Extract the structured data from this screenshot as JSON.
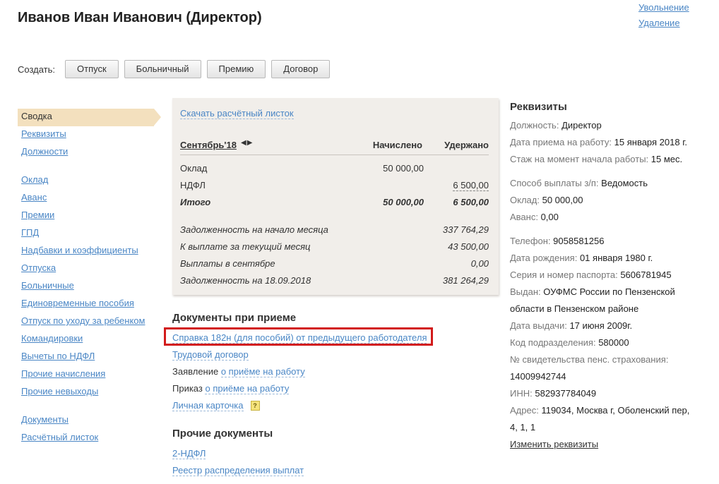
{
  "header": {
    "title": "Иванов Иван Иванович (Директор)",
    "dismiss": "Увольнение",
    "delete": "Удаление"
  },
  "create": {
    "label": "Создать:",
    "buttons": [
      "Отпуск",
      "Больничный",
      "Премию",
      "Договор"
    ]
  },
  "nav": {
    "items": [
      "Сводка",
      "Реквизиты",
      "Должности",
      "Оклад",
      "Аванс",
      "Премии",
      "ГПД",
      "Надбавки и коэффициенты",
      "Отпуска",
      "Больничные",
      "Единовременные пособия",
      "Отпуск по уходу за ребенком",
      "Командировки",
      "Вычеты по НДФЛ",
      "Прочие начисления",
      "Прочие невыходы",
      "Документы",
      "Расчётный листок"
    ]
  },
  "payslip": {
    "download": "Скачать расчётный листок",
    "month": "Сентябрь'18",
    "arrows": "◀▶",
    "col_accrued": "Начислено",
    "col_withheld": "Удержано",
    "rows": [
      {
        "label": "Оклад",
        "accrued": "50 000,00",
        "withheld": ""
      },
      {
        "label": "НДФЛ",
        "accrued": "",
        "withheld": "6 500,00"
      },
      {
        "label": "Итого",
        "accrued": "50 000,00",
        "withheld": "6 500,00"
      }
    ],
    "summary": [
      {
        "label": "Задолженность на начало месяца",
        "value": "337 764,29"
      },
      {
        "label": "К выплате за текущий месяц",
        "value": "43 500,00"
      },
      {
        "label": "Выплаты в сентябре",
        "value": "0,00"
      },
      {
        "label": "Задолженность на 18.09.2018",
        "value": "381 264,29"
      }
    ]
  },
  "hire_docs": {
    "heading": "Документы при приеме",
    "cert": "Справка 182н (для пособий) от предыдущего работодателя",
    "contract": "Трудовой договор",
    "application_prefix": "Заявление",
    "application_link": "о приёме на работу",
    "order_prefix": "Приказ",
    "order_link": "о приёме на работу",
    "card": "Личная карточка",
    "help": "?"
  },
  "other_docs": {
    "heading": "Прочие документы",
    "items": [
      "2-НДФЛ",
      "Реестр распределения выплат"
    ]
  },
  "requisites": {
    "title": "Реквизиты",
    "position_k": "Должность:",
    "position_v": "Директор",
    "hired_k": "Дата приема на работу:",
    "hired_v": "15 января 2018 г.",
    "tenure_k": "Стаж на момент начала работы:",
    "tenure_v": "15 мес.",
    "pay_method_k": "Способ выплаты з/п:",
    "pay_method_v": "Ведомость",
    "salary_k": "Оклад:",
    "salary_v": "50 000,00",
    "advance_k": "Аванс:",
    "advance_v": "0,00",
    "phone_k": "Телефон:",
    "phone_v": "9058581256",
    "birth_k": "Дата рождения:",
    "birth_v": "01 января 1980 г.",
    "passport_k": "Серия и номер паспорта:",
    "passport_v": "5606781945",
    "issued_k": "Выдан:",
    "issued_v1": "ОУФМС России по Пензенской",
    "issued_v2": "области в Пензенском районе",
    "issue_date_k": "Дата выдачи:",
    "issue_date_v": "17 июня 2009г.",
    "dept_code_k": "Код подразделения:",
    "dept_code_v": "580000",
    "snils_k": "№ свидетельства пенс. страхования:",
    "snils_v": "14009942744",
    "inn_k": "ИНН:",
    "inn_v": "582937784049",
    "address_k": "Адрес:",
    "address_v1": "119034, Москва г, Оболенский пер,",
    "address_v2": "4, 1, 1",
    "edit": "Изменить реквизиты"
  },
  "colors": {
    "link": "#4a86c5",
    "active_nav": "#f3e0be",
    "payslip_bg": "#f1eeea",
    "highlight": "#d21b1b"
  }
}
